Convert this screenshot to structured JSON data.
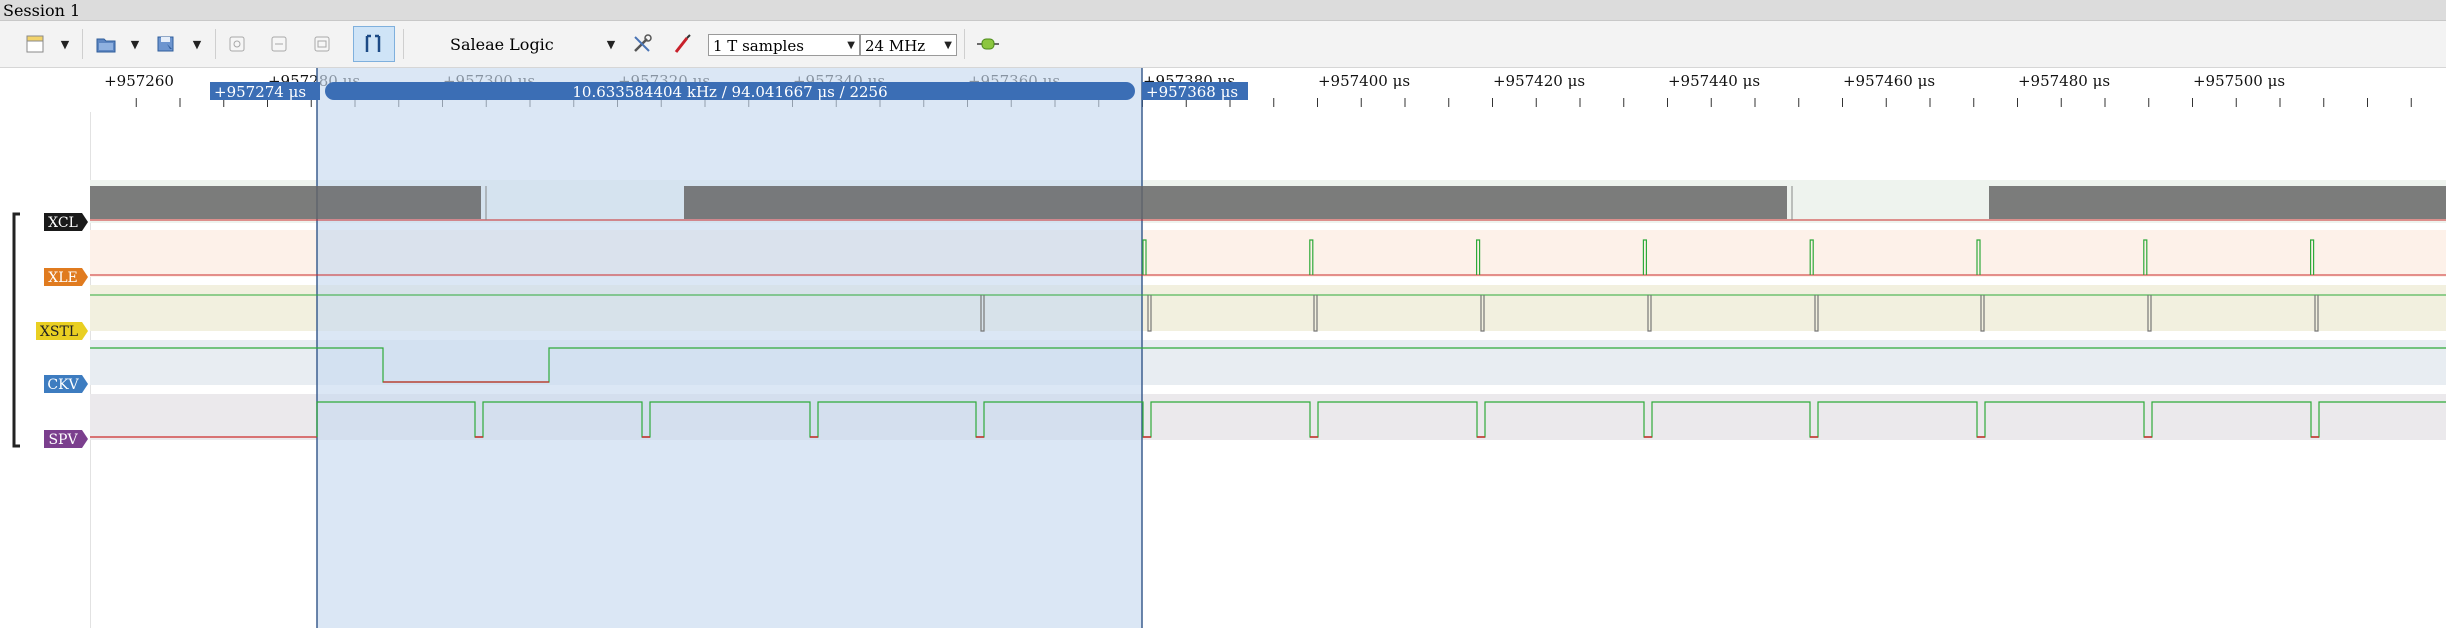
{
  "session": {
    "tab_label": "Session 1"
  },
  "toolbar": {
    "device_name": "Saleae Logic",
    "samples": "1 T samples",
    "rate": "24 MHz",
    "icons": [
      "new-session-icon",
      "open-folder-icon",
      "save-icon",
      "zoom-in-icon",
      "zoom-fit-icon",
      "zoom-out-icon",
      "cursor-pair-icon",
      "wrench-screwdriver-icon",
      "probe-pen-icon",
      "connect-status-icon"
    ]
  },
  "timeline": {
    "ticks": [
      "+957260",
      "+957280  μs",
      "+957300  μs",
      "+957320  μs",
      "+957340  μs",
      "+957360  μs",
      "+957380  μs",
      "+957400  μs",
      "+957420  μs",
      "+957440  μs",
      "+957460  μs",
      "+957480  μs",
      "+957500  μs"
    ],
    "cursor_start": "+957274  μs",
    "cursor_end": "+957368  μs",
    "measure": "10.633584404 kHz / 94.041667  μs / 2256"
  },
  "channels": [
    {
      "name": "XCL",
      "color": "#1a1a1a",
      "text_color": "#ffffff"
    },
    {
      "name": "XLE",
      "color": "#e07b1f",
      "text_color": "#ffffff"
    },
    {
      "name": "XSTL",
      "color": "#e9cf22",
      "text_color": "#222222"
    },
    {
      "name": "CKV",
      "color": "#3d7cc0",
      "text_color": "#ffffff"
    },
    {
      "name": "SPV",
      "color": "#7b3f8e",
      "text_color": "#ffffff"
    }
  ],
  "colors": {
    "selection": "#c8daf0",
    "marker": "#3b6eb5",
    "trace_high": "#2faa3a",
    "trace_low": "#cc2b2b"
  }
}
